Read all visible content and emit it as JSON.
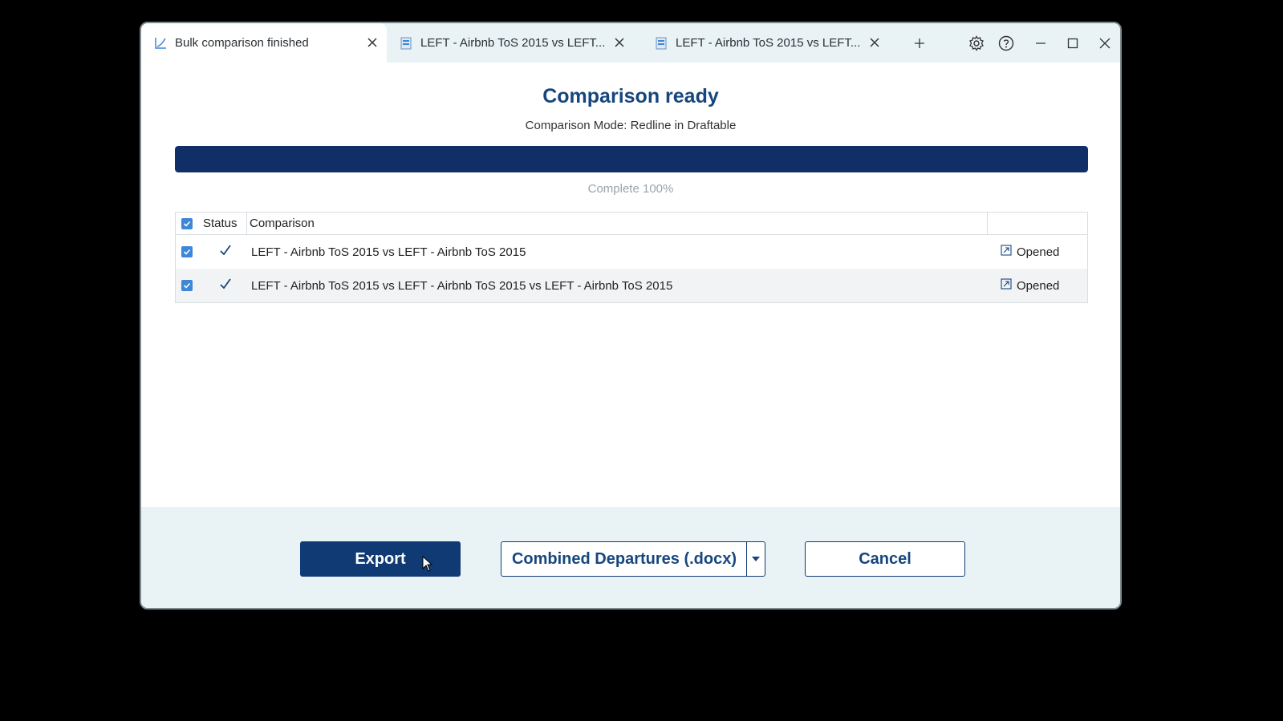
{
  "tabs": [
    {
      "label": "Bulk comparison finished",
      "active": true
    },
    {
      "label": "LEFT - Airbnb ToS 2015 vs LEFT...",
      "active": false
    },
    {
      "label": "LEFT - Airbnb ToS 2015 vs LEFT...",
      "active": false
    }
  ],
  "main": {
    "title": "Comparison ready",
    "subtitle": "Comparison Mode: Redline in Draftable",
    "progress_label": "Complete  100%",
    "progress_percent": 100
  },
  "table": {
    "headers": {
      "status": "Status",
      "comparison": "Comparison"
    },
    "rows": [
      {
        "name": "LEFT - Airbnb ToS 2015 vs LEFT - Airbnb ToS 2015",
        "action": "Opened"
      },
      {
        "name": "LEFT - Airbnb ToS 2015 vs LEFT - Airbnb ToS 2015 vs LEFT - Airbnb ToS 2015",
        "action": "Opened"
      }
    ]
  },
  "footer": {
    "export_label": "Export",
    "combined_label": "Combined Departures (.docx)",
    "cancel_label": "Cancel"
  },
  "colors": {
    "accent": "#0f3a73",
    "title": "#16467e",
    "checkbox": "#3d86d8",
    "footer_bg": "#e9f3f6"
  }
}
